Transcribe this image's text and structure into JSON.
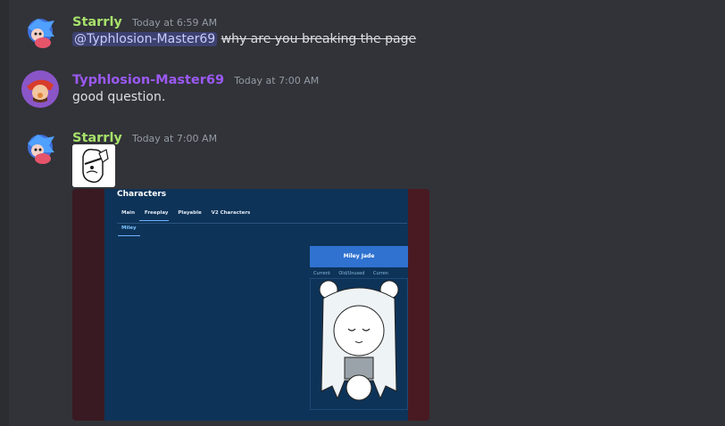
{
  "messages": [
    {
      "username": "Starrly",
      "username_color": "#a7e06a",
      "timestamp": "Today at 6:59 AM",
      "mention": "@Typhlosion-Master69",
      "text": "why are you breaking the page"
    },
    {
      "username": "Typhlosion-Master69",
      "username_color": "#9b59f2",
      "timestamp": "Today at 7:00 AM",
      "text": "good question."
    },
    {
      "username": "Starrly",
      "username_color": "#a7e06a",
      "timestamp": "Today at 7:00 AM",
      "screenshot": {
        "title": "Characters",
        "tabs": [
          "Main",
          "Freeplay",
          "Playable",
          "V2 Characters"
        ],
        "subtab": "Miley",
        "card_name": "Miley Jade",
        "card_tabs": [
          "Current",
          "Old/Unused",
          "Curren"
        ]
      }
    }
  ]
}
